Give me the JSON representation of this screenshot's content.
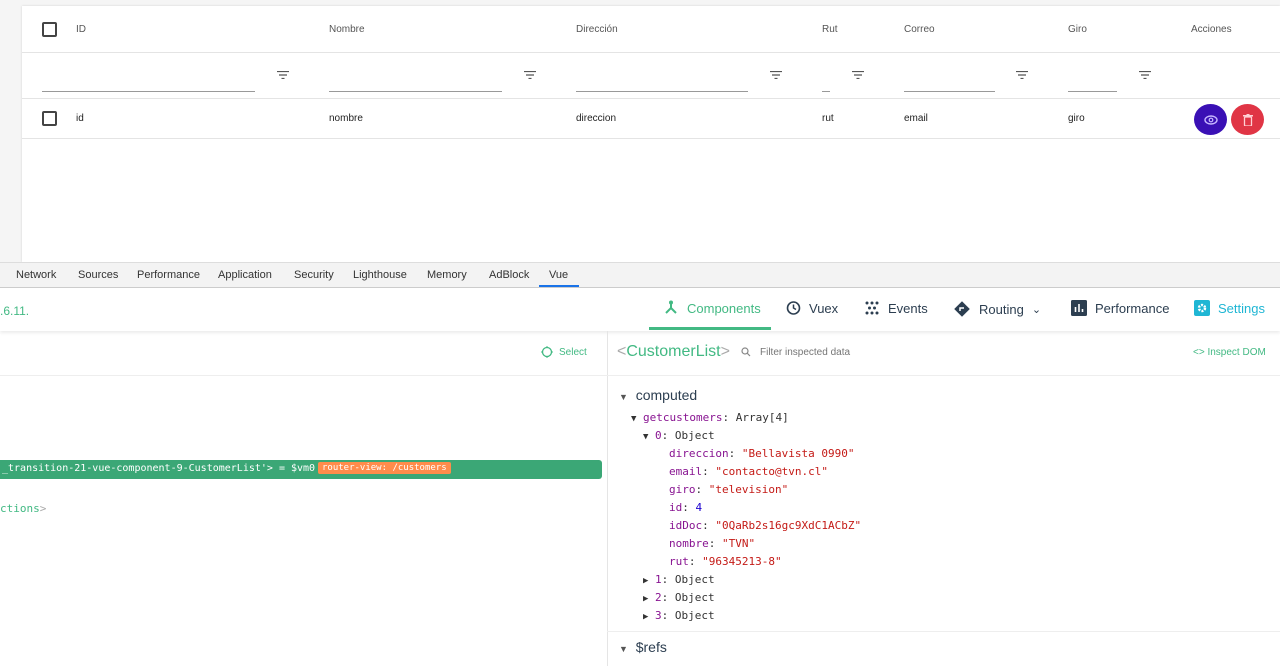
{
  "table": {
    "headers": [
      "ID",
      "Nombre",
      "Dirección",
      "Rut",
      "Correo",
      "Giro",
      "Acciones"
    ],
    "row": {
      "id": "id",
      "nombre": "nombre",
      "direccion": "direccion",
      "rut": "rut",
      "email": "email",
      "giro": "giro"
    },
    "actions": [
      {
        "icon": "eye-icon",
        "color": "#3a10b5"
      },
      {
        "icon": "trash-icon",
        "color": "#e03545"
      }
    ]
  },
  "devtools": {
    "tabs": [
      "Network",
      "Sources",
      "Performance",
      "Application",
      "Security",
      "Lighthouse",
      "Memory",
      "AdBlock",
      "Vue"
    ],
    "active_tab": "Vue"
  },
  "vue": {
    "version": ".6.11.",
    "tabs": [
      {
        "label": "Components",
        "icon": "components-icon"
      },
      {
        "label": "Vuex",
        "icon": "history-icon"
      },
      {
        "label": "Events",
        "icon": "events-icon"
      },
      {
        "label": "Routing",
        "icon": "routing-icon"
      },
      {
        "label": "Performance",
        "icon": "chart-icon"
      },
      {
        "label": "Settings",
        "icon": "gear-icon"
      }
    ],
    "active_tab": "Components",
    "select_label": "Select",
    "selected_row": {
      "text": "_transition-21-vue-component-9-CustomerList'> = $vm0",
      "badge": "router-view: /customers"
    },
    "row2": "ctions",
    "inspected": {
      "name": "CustomerList",
      "filter_placeholder": "Filter inspected data",
      "inspect_dom": "Inspect DOM"
    },
    "computed_label": "computed",
    "getcustomers": {
      "key": "getcustomers",
      "type": "Array[4]"
    },
    "item0": {
      "key": "0",
      "type": "Object",
      "fields": [
        {
          "k": "direccion",
          "v": "\"Bellavista 0990\"",
          "t": "str"
        },
        {
          "k": "email",
          "v": "\"contacto@tvn.cl\"",
          "t": "str"
        },
        {
          "k": "giro",
          "v": "\"television\"",
          "t": "str"
        },
        {
          "k": "id",
          "v": "4",
          "t": "num"
        },
        {
          "k": "idDoc",
          "v": "\"0QaRb2s16gc9XdC1ACbZ\"",
          "t": "str"
        },
        {
          "k": "nombre",
          "v": "\"TVN\"",
          "t": "str"
        },
        {
          "k": "rut",
          "v": "\"96345213-8\"",
          "t": "str"
        }
      ]
    },
    "collapsed": [
      {
        "key": "1",
        "type": "Object"
      },
      {
        "key": "2",
        "type": "Object"
      },
      {
        "key": "3",
        "type": "Object"
      }
    ],
    "refs_label": "$refs"
  },
  "colors": {
    "vue_green": "#42b983",
    "badge_orange": "#ff8c4b"
  }
}
